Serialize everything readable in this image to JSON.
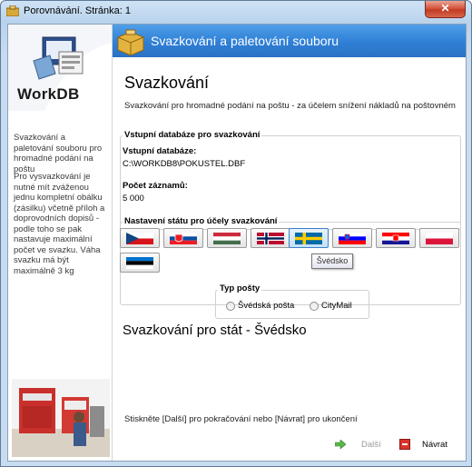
{
  "window": {
    "title": "Porovnávání. Stránka: 1",
    "close_label": "✕"
  },
  "sidebar": {
    "logo_text": "WorkDB",
    "intro": "Svazkování a paletování souboru pro hromadné podání na poštu",
    "note": "Pro vysvazkování je nutné mít zváženou jednu kompletní obálku (zásilku) včetně příloh a doprovodních dopisů - podle toho se pak nastavuje maximální počet ve svazku. Váha svazku má být maximálně 3 kg"
  },
  "header": {
    "title": "Svazkování a paletování souboru"
  },
  "page": {
    "title": "Svazkování",
    "description": "Svazkování pro hromadné podání na poštu - za účelem snížení nákladů na poštovném"
  },
  "input_db": {
    "group_label": "Vstupní databáze pro svazkování",
    "db_label": "Vstupní databáze:",
    "db_path": "C:\\WORKDB8\\POKUSTEL.DBF",
    "count_label": "Počet záznamů:",
    "count_value": "5 000"
  },
  "countries": {
    "group_label": "Nastavení státu pro účely svazkování",
    "flags": [
      {
        "name": "czech",
        "selected": false
      },
      {
        "name": "slovakia",
        "selected": false
      },
      {
        "name": "hungary",
        "selected": false
      },
      {
        "name": "norway",
        "selected": false
      },
      {
        "name": "sweden",
        "selected": true
      },
      {
        "name": "slovenia",
        "selected": false
      },
      {
        "name": "croatia",
        "selected": false
      },
      {
        "name": "poland",
        "selected": false
      },
      {
        "name": "estonia",
        "selected": false
      }
    ],
    "tooltip": "Švédsko"
  },
  "post_type": {
    "group_label": "Typ pošty",
    "options": [
      "Švédská pošta",
      "CityMail"
    ]
  },
  "status": {
    "text": "Svazkování pro stát  - Švédsko"
  },
  "footer": {
    "hint": "Stiskněte [Další] pro pokračování nebo [Návrat] pro ukončení",
    "next_label": "Další",
    "back_label": "Návrat"
  },
  "colors": {
    "header_blue": "#2f7fd6",
    "titlebar": "#b9d2ec",
    "close_red": "#c23a22"
  }
}
